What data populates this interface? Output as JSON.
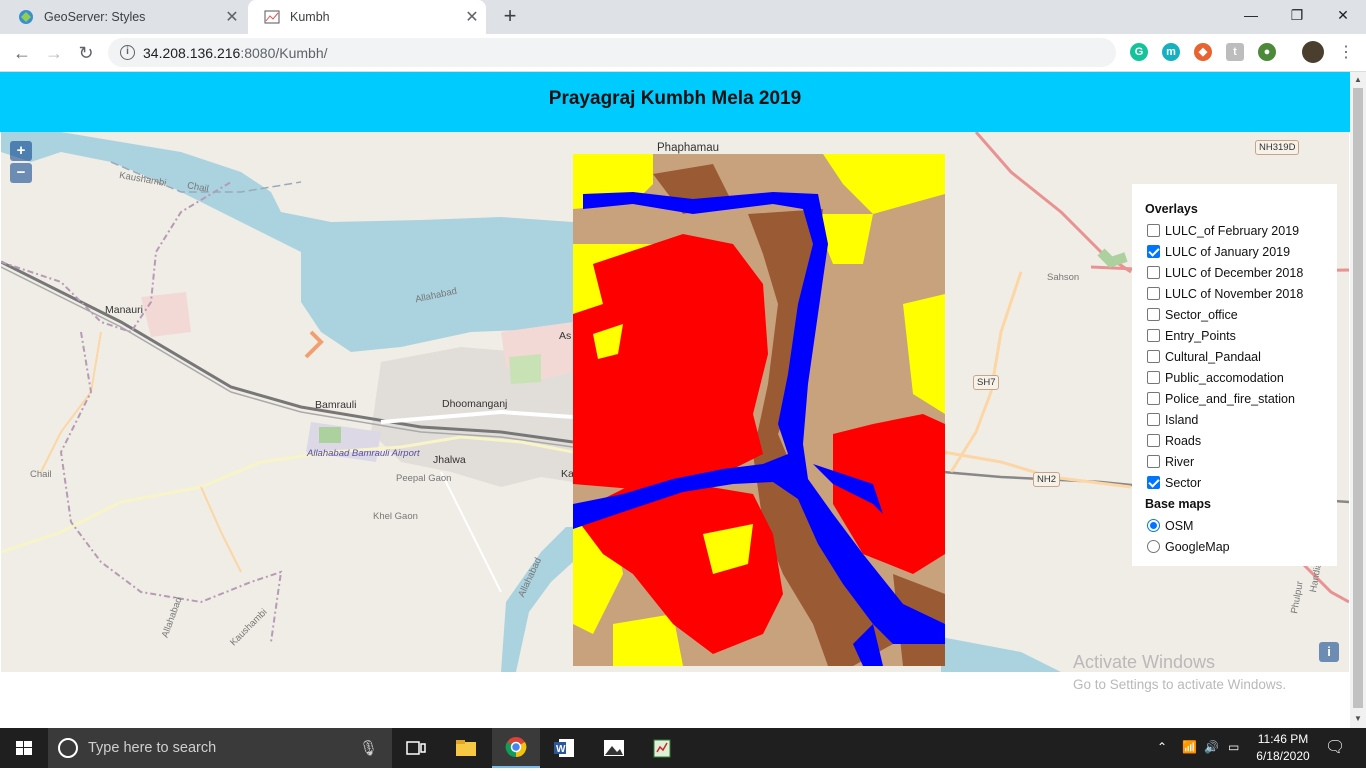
{
  "browser": {
    "tabs": [
      {
        "title": "GeoServer: Styles",
        "active": false
      },
      {
        "title": "Kumbh",
        "active": true
      }
    ],
    "url_host": "34.208.136.216",
    "url_path": ":8080/Kumbh/"
  },
  "page": {
    "title": "Prayagraj Kumbh Mela 2019"
  },
  "map": {
    "zoom_in": "+",
    "zoom_out": "−",
    "info": "i",
    "labels": {
      "phaphamau": "Phaphamau",
      "kaushambi_top": "Kaushambi",
      "chail_top": "Chail",
      "manauri": "Manauri",
      "allahabad_river": "Allahabad",
      "bamrauli": "Bamrauli",
      "dhoomanganj": "Dhoomanganj",
      "airport": "Allahabad Bamrauli Airport",
      "jhalwa": "Jhalwa",
      "peepal_gaon": "Peepal Gaon",
      "chail_left": "Chail",
      "khel_gaon": "Khel Gaon",
      "allahabad_bottom": "Allahabad",
      "allahabad_bottom2": "Allahabad",
      "kaushambi_bottom": "Kaushambi",
      "sahson": "Sahson",
      "phulpur": "Phulpur",
      "handia": "Handia",
      "as_partial": "As",
      "ka_partial": "Ka"
    },
    "shields": {
      "nh319d": "NH319D",
      "sh7": "SH7",
      "nh2": "NH2"
    },
    "overlay_colors": {
      "water": "#0000ff",
      "urban": "#ff0000",
      "vegetation": "#ffff00",
      "sand": "#c8a27c",
      "bare": "#9a5a34"
    }
  },
  "layer_switcher": {
    "overlays_title": "Overlays",
    "overlays": [
      {
        "label": "LULC_of February 2019",
        "checked": false
      },
      {
        "label": "LULC of January 2019",
        "checked": true
      },
      {
        "label": "LULC of December 2018",
        "checked": false
      },
      {
        "label": "LULC of November 2018",
        "checked": false
      },
      {
        "label": "Sector_office",
        "checked": false
      },
      {
        "label": "Entry_Points",
        "checked": false
      },
      {
        "label": "Cultural_Pandaal",
        "checked": false
      },
      {
        "label": "Public_accomodation",
        "checked": false
      },
      {
        "label": "Police_and_fire_station",
        "checked": false
      },
      {
        "label": "Island",
        "checked": false
      },
      {
        "label": "Roads",
        "checked": false
      },
      {
        "label": "River",
        "checked": false
      },
      {
        "label": "Sector",
        "checked": true
      }
    ],
    "basemaps_title": "Base maps",
    "basemaps": [
      {
        "label": "OSM",
        "checked": true
      },
      {
        "label": "GoogleMap",
        "checked": false
      }
    ]
  },
  "watermark": {
    "line1": "Activate Windows",
    "line2": "Go to Settings to activate Windows."
  },
  "taskbar": {
    "search_placeholder": "Type here to search",
    "time": "11:46 PM",
    "date": "6/18/2020"
  }
}
